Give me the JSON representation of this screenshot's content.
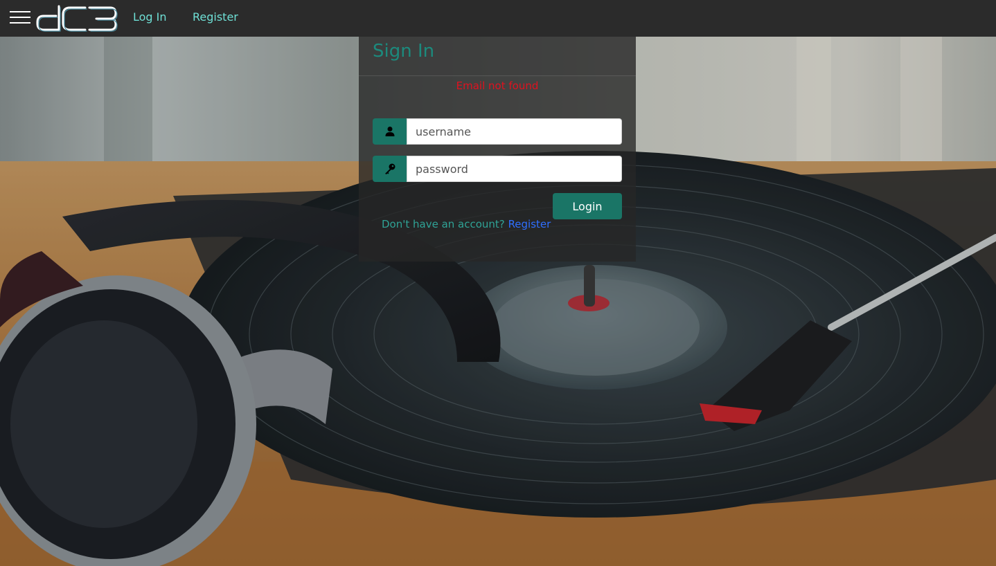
{
  "navbar": {
    "menu_icon": "hamburger-menu-icon",
    "logo_text": "dc3",
    "links": [
      {
        "label": "Log In"
      },
      {
        "label": "Register"
      }
    ]
  },
  "signin": {
    "title": "Sign In",
    "error": "Email not found",
    "username_placeholder": "username",
    "username_icon": "user-icon",
    "password_placeholder": "password",
    "password_icon": "key-icon",
    "login_label": "Login",
    "no_account_text": "Don't have an account?",
    "register_link": "Register"
  },
  "colors": {
    "accent": "#1a7566",
    "title": "#1c8a7d",
    "link": "#2f6fff",
    "error": "#e0111f",
    "navbar_bg": "#2b2b2b"
  }
}
